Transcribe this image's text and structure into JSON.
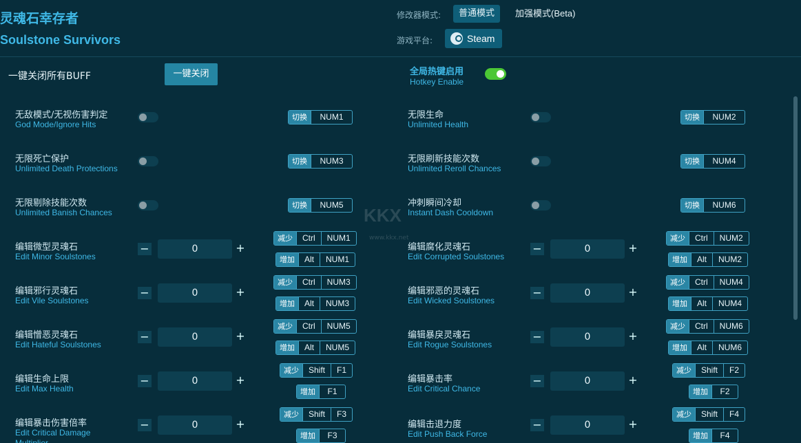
{
  "title_cn": "灵魂石幸存者",
  "title_en": "Soulstone Survivors",
  "mode": {
    "label": "修改器模式:",
    "normal": "普通模式",
    "beta": "加强模式(Beta)"
  },
  "platform": {
    "label": "游戏平台:",
    "steam": "Steam"
  },
  "buff": {
    "label": "一键关闭所有BUFF",
    "button": "一键关闭"
  },
  "hotkey": {
    "cn": "全局热键启用",
    "en": "Hotkey Enable",
    "enabled": true
  },
  "watermark": {
    "text": "KKX",
    "url": "www.kkx.net"
  },
  "labels": {
    "toggle": "切换",
    "dec": "减少",
    "inc": "增加"
  },
  "toggles": [
    {
      "cn": "无敌模式/无视伤害判定",
      "en": "God Mode/Ignore Hits",
      "key": "NUM1",
      "on": false
    },
    {
      "cn": "无限生命",
      "en": "Unlimited Health",
      "key": "NUM2",
      "on": false
    },
    {
      "cn": "无限死亡保护",
      "en": "Unlimited Death Protections",
      "key": "NUM3",
      "on": false
    },
    {
      "cn": "无限刷新技能次数",
      "en": "Unlimited Reroll Chances",
      "key": "NUM4",
      "on": false
    },
    {
      "cn": "无限剔除技能次数",
      "en": "Unlimited Banish Chances",
      "key": "NUM5",
      "on": false
    },
    {
      "cn": "冲刺瞬间冷却",
      "en": "Instant Dash Cooldown",
      "key": "NUM6",
      "on": false
    }
  ],
  "editors": [
    {
      "cn": "编辑微型灵魂石",
      "en": "Edit Minor Soulstones",
      "value": "0",
      "dec": [
        "Ctrl",
        "NUM1"
      ],
      "inc": [
        "Alt",
        "NUM1"
      ]
    },
    {
      "cn": "编辑腐化灵魂石",
      "en": "Edit Corrupted Soulstones",
      "value": "0",
      "dec": [
        "Ctrl",
        "NUM2"
      ],
      "inc": [
        "Alt",
        "NUM2"
      ]
    },
    {
      "cn": "编辑邪行灵魂石",
      "en": "Edit Vile Soulstones",
      "value": "0",
      "dec": [
        "Ctrl",
        "NUM3"
      ],
      "inc": [
        "Alt",
        "NUM3"
      ]
    },
    {
      "cn": "编辑邪恶的灵魂石",
      "en": "Edit Wicked Soulstones",
      "value": "0",
      "dec": [
        "Ctrl",
        "NUM4"
      ],
      "inc": [
        "Alt",
        "NUM4"
      ]
    },
    {
      "cn": "编辑憎恶灵魂石",
      "en": "Edit Hateful Soulstones",
      "value": "0",
      "dec": [
        "Ctrl",
        "NUM5"
      ],
      "inc": [
        "Alt",
        "NUM5"
      ]
    },
    {
      "cn": "编辑暴戾灵魂石",
      "en": "Edit Rogue Soulstones",
      "value": "0",
      "dec": [
        "Ctrl",
        "NUM6"
      ],
      "inc": [
        "Alt",
        "NUM6"
      ]
    },
    {
      "cn": "编辑生命上限",
      "en": "Edit Max Health",
      "value": "0",
      "dec": [
        "Shift",
        "F1"
      ],
      "inc": [
        "F1"
      ]
    },
    {
      "cn": "编辑暴击率",
      "en": "Edit Critical Chance",
      "value": "0",
      "dec": [
        "Shift",
        "F2"
      ],
      "inc": [
        "F2"
      ]
    },
    {
      "cn": "编辑暴击伤害倍率",
      "en": "Edit Critical Damage Multiplier",
      "value": "0",
      "dec": [
        "Shift",
        "F3"
      ],
      "inc": [
        "F3"
      ]
    },
    {
      "cn": "编辑击退力度",
      "en": "Edit Push Back Force",
      "value": "0",
      "dec": [
        "Shift",
        "F4"
      ],
      "inc": [
        "F4"
      ]
    }
  ]
}
